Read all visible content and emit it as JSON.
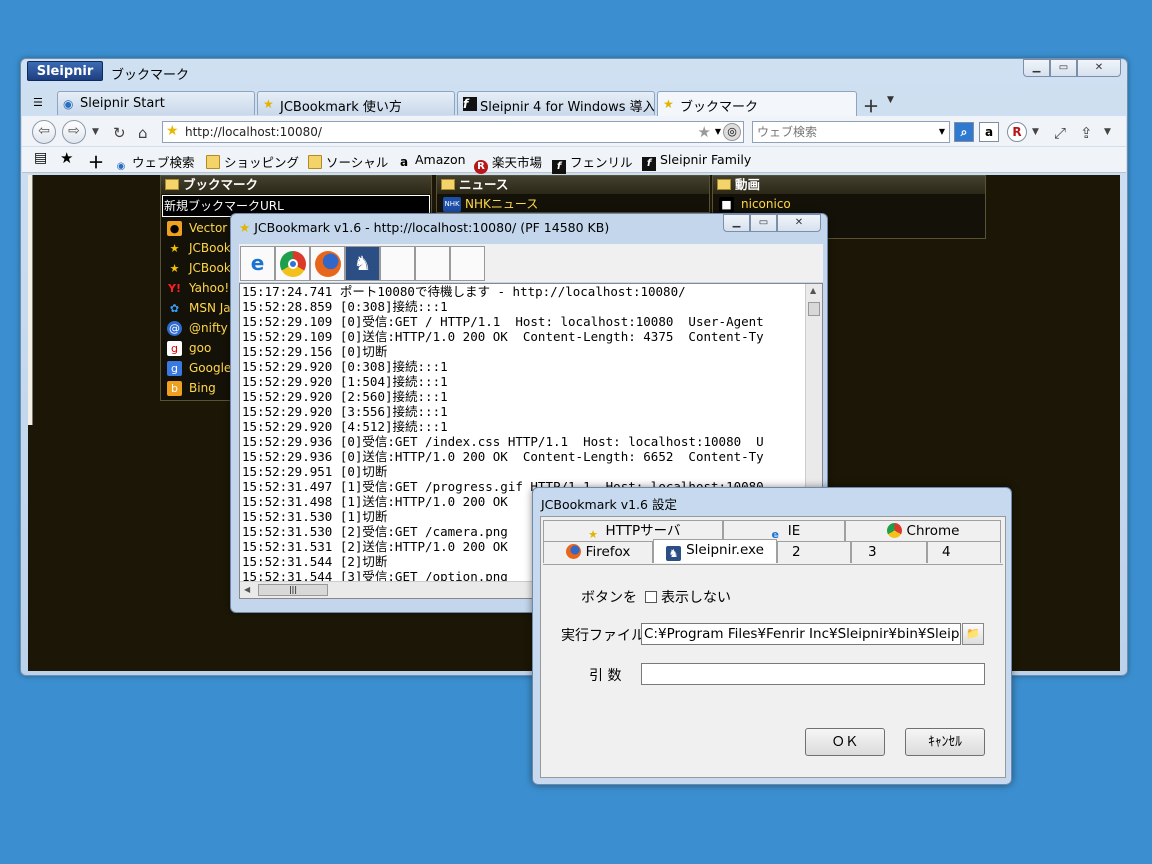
{
  "browser": {
    "app_name": "Sleipnir",
    "title": "ブックマーク",
    "controls": {
      "minimize": "▁",
      "maximize": "▭",
      "close": "✕"
    },
    "tabs": [
      {
        "label": "Sleipnir Start"
      },
      {
        "label": "JCBookmark 使い方"
      },
      {
        "label": "Sleipnir 4 for Windows 導入..."
      },
      {
        "label": "ブックマーク"
      }
    ],
    "address": "http://localhost:10080/",
    "search_placeholder": "ウェブ検索",
    "bookmarks_bar": [
      {
        "label": "ウェブ検索",
        "icon": "globe-icon"
      },
      {
        "label": "ショッピング",
        "icon": "folder-icon"
      },
      {
        "label": "ソーシャル",
        "icon": "folder-icon"
      },
      {
        "label": "Amazon",
        "icon": "amazon-icon"
      },
      {
        "label": "楽天市場",
        "icon": "rakuten-icon"
      },
      {
        "label": "フェンリル",
        "icon": "fenrir-icon"
      },
      {
        "label": "Sleipnir Family",
        "icon": "fenrir-icon"
      }
    ]
  },
  "page": {
    "panels": [
      {
        "title": "ブックマーク",
        "new_url": "新規ブックマークURL",
        "items": [
          "Vector",
          "JCBook",
          "JCBook",
          "Yahoo!",
          "MSN Ja",
          "@nifty",
          "goo",
          "Google",
          "Bing"
        ]
      },
      {
        "title": "ニュース",
        "items": [
          "NHKニュース"
        ]
      },
      {
        "title": "動画",
        "items": [
          "niconico"
        ]
      }
    ]
  },
  "logwin": {
    "title": "JCBookmark v1.6 - http://localhost:10080/ (PF 14580 KB)",
    "toolbar": [
      "ie-icon",
      "chrome-icon",
      "firefox-icon",
      "sleipnir-icon",
      "",
      "",
      ""
    ],
    "lines": [
      "15:17:24.741 ポート10080で待機します - http://localhost:10080/",
      "15:52:28.859 [0:308]接続:::1",
      "15:52:29.109 [0]受信:GET / HTTP/1.1  Host: localhost:10080  User-Agent",
      "15:52:29.109 [0]送信:HTTP/1.0 200 OK  Content-Length: 4375  Content-Ty",
      "15:52:29.156 [0]切断",
      "15:52:29.920 [0:308]接続:::1",
      "15:52:29.920 [1:504]接続:::1",
      "15:52:29.920 [2:560]接続:::1",
      "15:52:29.920 [3:556]接続:::1",
      "15:52:29.920 [4:512]接続:::1",
      "15:52:29.936 [0]受信:GET /index.css HTTP/1.1  Host: localhost:10080  U",
      "15:52:29.936 [0]送信:HTTP/1.0 200 OK  Content-Length: 6652  Content-Ty",
      "15:52:29.951 [0]切断",
      "15:52:31.497 [1]受信:GET /progress.gif HTTP/1.1  Host: localhost:10080",
      "15:52:31.498 [1]送信:HTTP/1.0 200 OK",
      "15:52:31.530 [1]切断",
      "15:52:31.530 [2]受信:GET /camera.png",
      "15:52:31.531 [2]送信:HTTP/1.0 200 OK",
      "15:52:31.544 [2]切断",
      "15:52:31.544 [3]受信:GET /option.png"
    ]
  },
  "dialog": {
    "title": "JCBookmark v1.6 設定",
    "tabs_row1": [
      "HTTPサーバ",
      "IE",
      "Chrome"
    ],
    "tabs_row2": [
      "Firefox",
      "Sleipnir.exe",
      "2",
      "3",
      "4"
    ],
    "button_label": "ボタンを",
    "hide_label": "表示しない",
    "hide_checked": false,
    "exe_label": "実行ファイル",
    "exe_value": "C:¥Program Files¥Fenrir Inc¥Sleipnir¥bin¥Sleipnir",
    "args_label": "引 数",
    "args_value": "",
    "ok": "ＯＫ",
    "cancel": "ｷｬﾝｾﾙ"
  }
}
